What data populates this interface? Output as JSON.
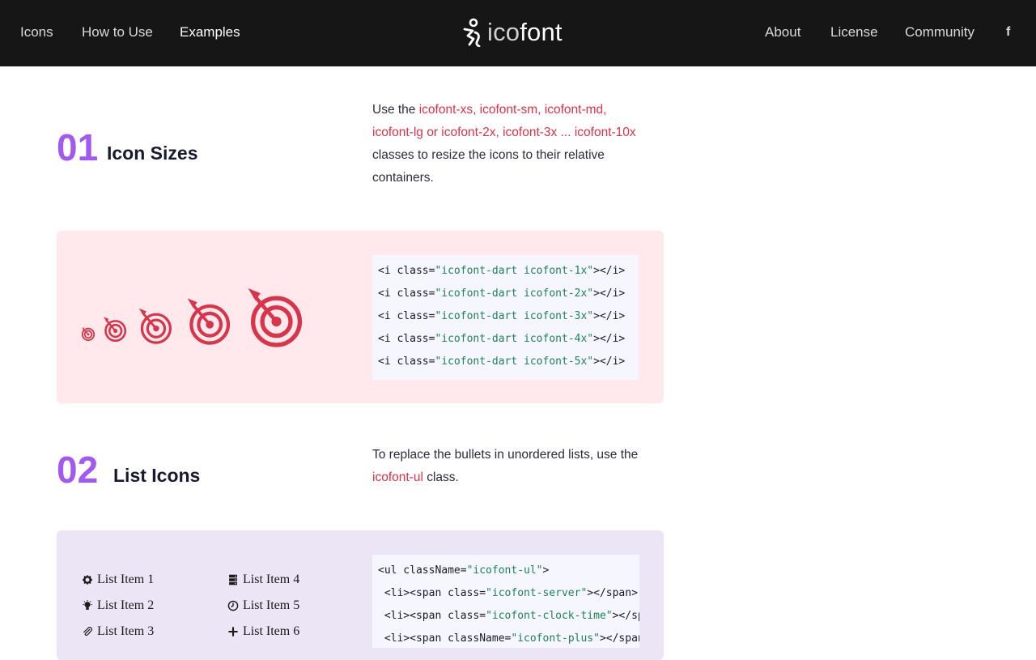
{
  "nav": {
    "left": [
      "Icons",
      "How to Use",
      "Examples"
    ],
    "active": "Examples",
    "brand_prefix": "ico",
    "brand_suffix": "font",
    "right": [
      "About",
      "License",
      "Community"
    ],
    "social_icon": "facebook-icon",
    "social_label": "f"
  },
  "sections": [
    {
      "number": "01",
      "title": "Icon Sizes",
      "desc_prefix": "Use the ",
      "desc_highlight_1": "icofont-xs, icofont-sm, icofont-md,",
      "desc_highlight_2": "icofont-lg or icofont-2x, icofont-3x ... icofont-10x",
      "desc_suffix_1": "classes to resize the icons to their relative",
      "desc_suffix_2": "containers.",
      "example_icon": "dart-icon",
      "code_lines": [
        {
          "pre": "<i class=",
          "str": "\"icofont-dart icofont-1x\"",
          "post": "></i>"
        },
        {
          "pre": "<i class=",
          "str": "\"icofont-dart icofont-2x\"",
          "post": "></i>"
        },
        {
          "pre": "<i class=",
          "str": "\"icofont-dart icofont-3x\"",
          "post": "></i>"
        },
        {
          "pre": "<i class=",
          "str": "\"icofont-dart icofont-4x\"",
          "post": "></i>"
        },
        {
          "pre": "<i class=",
          "str": "\"icofont-dart icofont-5x\"",
          "post": "></i>"
        }
      ]
    },
    {
      "number": "02",
      "title": "List Icons",
      "desc_prefix": "To replace the bullets in unordered lists, use the",
      "desc_highlight": "icofont-ul",
      "desc_suffix": " class.",
      "list_items": [
        {
          "label": "List Item 1",
          "icon": "gear-icon"
        },
        {
          "label": "List Item 2",
          "icon": "bulb-icon"
        },
        {
          "label": "List Item 3",
          "icon": "paperclip-icon"
        },
        {
          "label": "List Item 4",
          "icon": "server-icon"
        },
        {
          "label": "List Item 5",
          "icon": "clock-icon"
        },
        {
          "label": "List Item 6",
          "icon": "plus-icon"
        }
      ],
      "code_lines": [
        {
          "pre": "<ul className=",
          "str": "\"icofont-ul\"",
          "post": ">"
        },
        {
          "pre": " <li><span class=",
          "str": "\"icofont-server\"",
          "post": "></span>"
        },
        {
          "pre": " <li><span class=",
          "str": "\"icofont-clock-time\"",
          "post": "></span>"
        },
        {
          "pre": " <li><span className=",
          "str": "\"icofont-plus\"",
          "post": "></span>"
        }
      ]
    }
  ],
  "colors": {
    "nav_bg": "#161616",
    "accent_purple": "#a259f0",
    "highlight_red": "#d8344a",
    "pink_panel": "#ffe9ec",
    "lavender_panel": "#ece5f5",
    "code_string": "#218057"
  }
}
